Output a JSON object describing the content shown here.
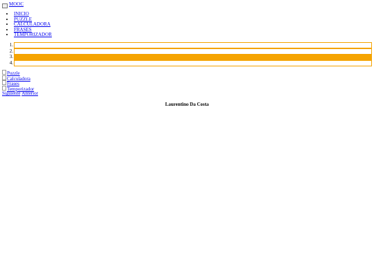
{
  "header": {
    "brand": "MOOC"
  },
  "nav": {
    "items": [
      "INICIO",
      "PUZZLE",
      "CALCULADORA",
      "FRASES",
      "TEMPORIZADOR"
    ]
  },
  "slider": {
    "indicators": [
      "1.",
      "2.",
      "3.",
      "4."
    ],
    "active_index": 3,
    "colors": {
      "accent": "#f6a400",
      "border": "#f4a300"
    }
  },
  "images": {
    "alts": [
      "Puzzle",
      "Calculadora",
      "Frases",
      "Temporizador"
    ]
  },
  "controls": {
    "next": "Siguiente",
    "prev": "Anterior"
  },
  "footer": {
    "author": "Laurentino Da Costa"
  }
}
